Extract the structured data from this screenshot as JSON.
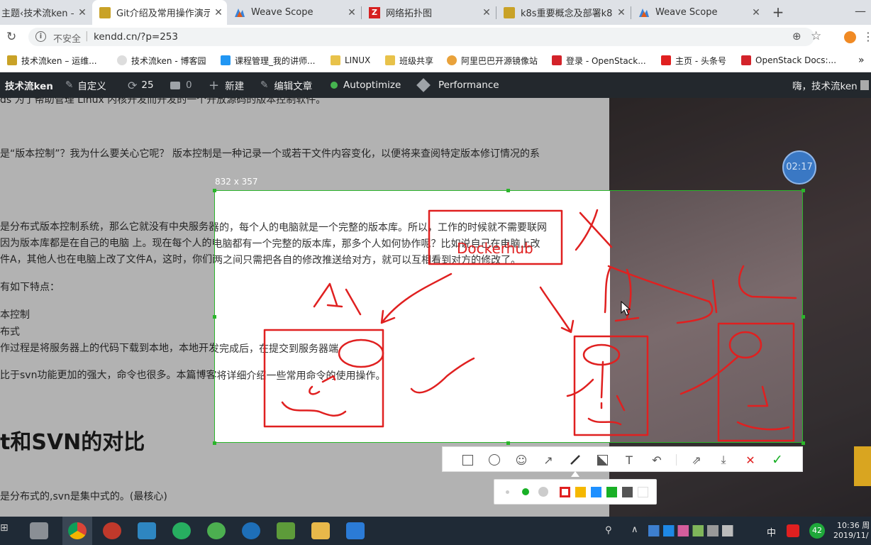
{
  "tabs": [
    {
      "title": "主题‹技术流ken —",
      "active": false
    },
    {
      "title": "Git介绍及常用操作演示",
      "active": true
    },
    {
      "title": "Weave Scope",
      "active": false
    },
    {
      "title": "网络拓扑图",
      "active": false
    },
    {
      "title": "k8s重要概念及部署k8s",
      "active": false
    },
    {
      "title": "Weave Scope",
      "active": false
    }
  ],
  "addressbar": {
    "security": "不安全",
    "separator": "|",
    "url": "kendd.cn/?p=253"
  },
  "bookmarks": [
    "技术流ken – 运维...",
    "技术流ken - 博客园",
    "课程管理_我的讲师...",
    "LINUX",
    "班级共享",
    "阿里巴巴开源镜像站",
    "登录 - OpenStack...",
    "主页 - 头条号",
    "OpenStack Docs:..."
  ],
  "adminbar": {
    "site": "技术流ken",
    "customize": "自定义",
    "updates": "25",
    "comments": "0",
    "new": "新建",
    "edit": "编辑文章",
    "autoptimize": "Autoptimize",
    "performance": "Performance",
    "greeting": "嗨，技术流ken"
  },
  "article": {
    "line_top": "ds 为了帮助管理 Linux 内核开发而开发的一个开放源码的版本控制软件。",
    "line_1": "是“版本控制”？我为什么要关心它呢？ 版本控制是一种记录一个或若干文件内容变化，以便将来查阅特定版本修订情况的系",
    "line_2": "是分布式版本控制系统，那么它就没有中央服务器的，每个人的电脑就是一个完整的版本库。所以，工作的时候就不需要联网",
    "line_3": "因为版本库都是在自己的电脑 上。现在每个人的电脑都有一个完整的版本库，那多个人如何协作呢？比如说自己在电脑上改",
    "line_4": "件A，其他人也在电脑上改了文件A，这时，你们两之间只需把各自的修改推送给对方，就可以互相看到对方的修改了。",
    "line_5": "有如下特点：",
    "line_6": "本控制",
    "line_7": "布式",
    "line_8": "作过程是将服务器上的代码下载到本地，本地开发完成后，在提交到服务器端",
    "line_9": "比于svn功能更加的强大，命令也很多。本篇博客将详细介绍一些常用命令的使用操作。",
    "heading": "t和SVN的对比",
    "line_10": "是分布式的,svn是集中式的。(最核心)"
  },
  "screenshot_tool": {
    "size_label": "832 x 357",
    "annotation_text": "Dockerhub",
    "tools": [
      "rectangle-icon",
      "ellipse-icon",
      "emoji-icon",
      "arrow-icon",
      "pen-icon",
      "mosaic-icon",
      "text-icon",
      "undo-icon",
      "share-icon",
      "download-icon",
      "cancel-icon",
      "confirm-icon"
    ],
    "colors": [
      "#e02020",
      "#f5b800",
      "#1e90ff",
      "#19b026",
      "#555555",
      "#ffffff"
    ],
    "selected_color": "#e02020"
  },
  "timer": "02:17",
  "taskbar": {
    "time": "10:36 周",
    "date": "2019/11/",
    "ime": "中",
    "badge": "42"
  }
}
